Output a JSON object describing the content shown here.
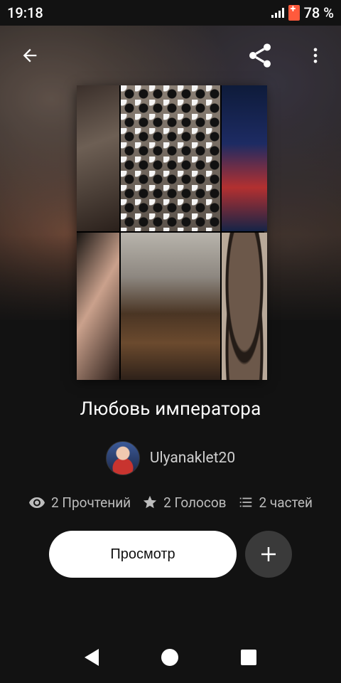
{
  "status_bar": {
    "time": "19:18",
    "battery": "78 %"
  },
  "story": {
    "title": "Любовь императора",
    "author": "Ulyanaklet20",
    "reads": "2 Прочтений",
    "votes": "2 Голосов",
    "parts": "2 частей"
  },
  "actions": {
    "read_label": "Просмотр"
  },
  "icons": {
    "back": "arrow-left-icon",
    "share": "share-icon",
    "more": "more-vert-icon",
    "reads": "eye-icon",
    "votes": "star-icon",
    "parts": "list-icon",
    "add": "plus-icon"
  }
}
